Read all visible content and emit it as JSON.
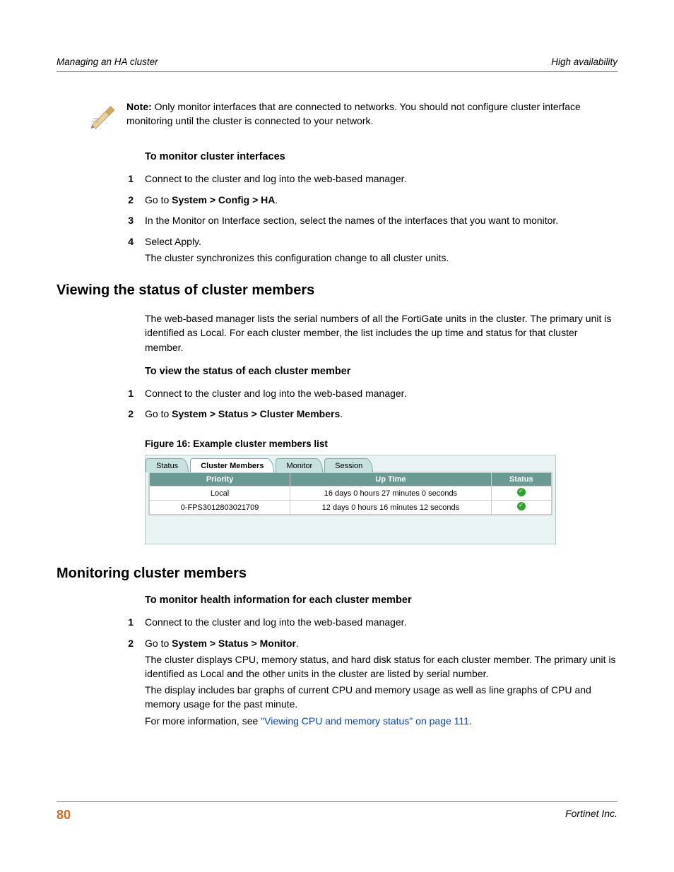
{
  "header": {
    "left": "Managing an HA cluster",
    "right": "High availability"
  },
  "note": {
    "label": "Note:",
    "text": "Only monitor interfaces that are connected to networks. You should not configure cluster interface monitoring until the cluster is connected to your network."
  },
  "proc1": {
    "title": "To monitor cluster interfaces",
    "items": [
      {
        "n": "1",
        "t": "Connect to the cluster and log into the web-based manager."
      },
      {
        "n": "2",
        "t_pre": "Go to ",
        "t_bold": "System > Config > HA",
        "t_post": "."
      },
      {
        "n": "3",
        "t": "In the Monitor on Interface section, select the names of the interfaces that you want to monitor."
      },
      {
        "n": "4",
        "t": "Select Apply.",
        "sub": "The cluster synchronizes this configuration change to all cluster units."
      }
    ]
  },
  "section1": {
    "heading": "Viewing the status of cluster members",
    "intro": "The web-based manager lists the serial numbers of all the FortiGate units in the cluster. The primary unit is identified as Local. For each cluster member, the list includes the up time and status for that cluster member.",
    "proc_title": "To view the status of each cluster member",
    "items": [
      {
        "n": "1",
        "t": "Connect to the cluster and log into the web-based manager."
      },
      {
        "n": "2",
        "t_pre": "Go to ",
        "t_bold": "System > Status > Cluster Members",
        "t_post": "."
      }
    ],
    "fig_caption": "Figure 16: Example cluster members list",
    "figure": {
      "tabs": [
        "Status",
        "Cluster Members",
        "Monitor",
        "Session"
      ],
      "active_tab": 1,
      "columns": [
        "Priority",
        "Up Time",
        "Status"
      ],
      "rows": [
        {
          "priority": "Local",
          "uptime": "16 days 0 hours 27 minutes 0 seconds"
        },
        {
          "priority": "0-FPS3012803021709",
          "uptime": "12 days 0 hours 16 minutes 12 seconds"
        }
      ]
    }
  },
  "section2": {
    "heading": "Monitoring cluster members",
    "proc_title": "To monitor health information for each cluster member",
    "items": [
      {
        "n": "1",
        "t": "Connect to the cluster and log into the web-based manager."
      },
      {
        "n": "2",
        "t_pre": "Go to ",
        "t_bold": "System > Status > Monitor",
        "t_post": ".",
        "paras": [
          "The cluster displays CPU, memory status, and hard disk status for each cluster member. The primary unit is identified as Local and the other units in the cluster are listed by serial number.",
          "The display includes bar graphs of current CPU and memory usage as well as line graphs of CPU and memory usage for the past minute."
        ],
        "xref_pre": "For more information, see ",
        "xref": "\"Viewing CPU and memory status\" on page 111",
        "xref_post": "."
      }
    ]
  },
  "footer": {
    "page": "80",
    "company": "Fortinet Inc."
  }
}
